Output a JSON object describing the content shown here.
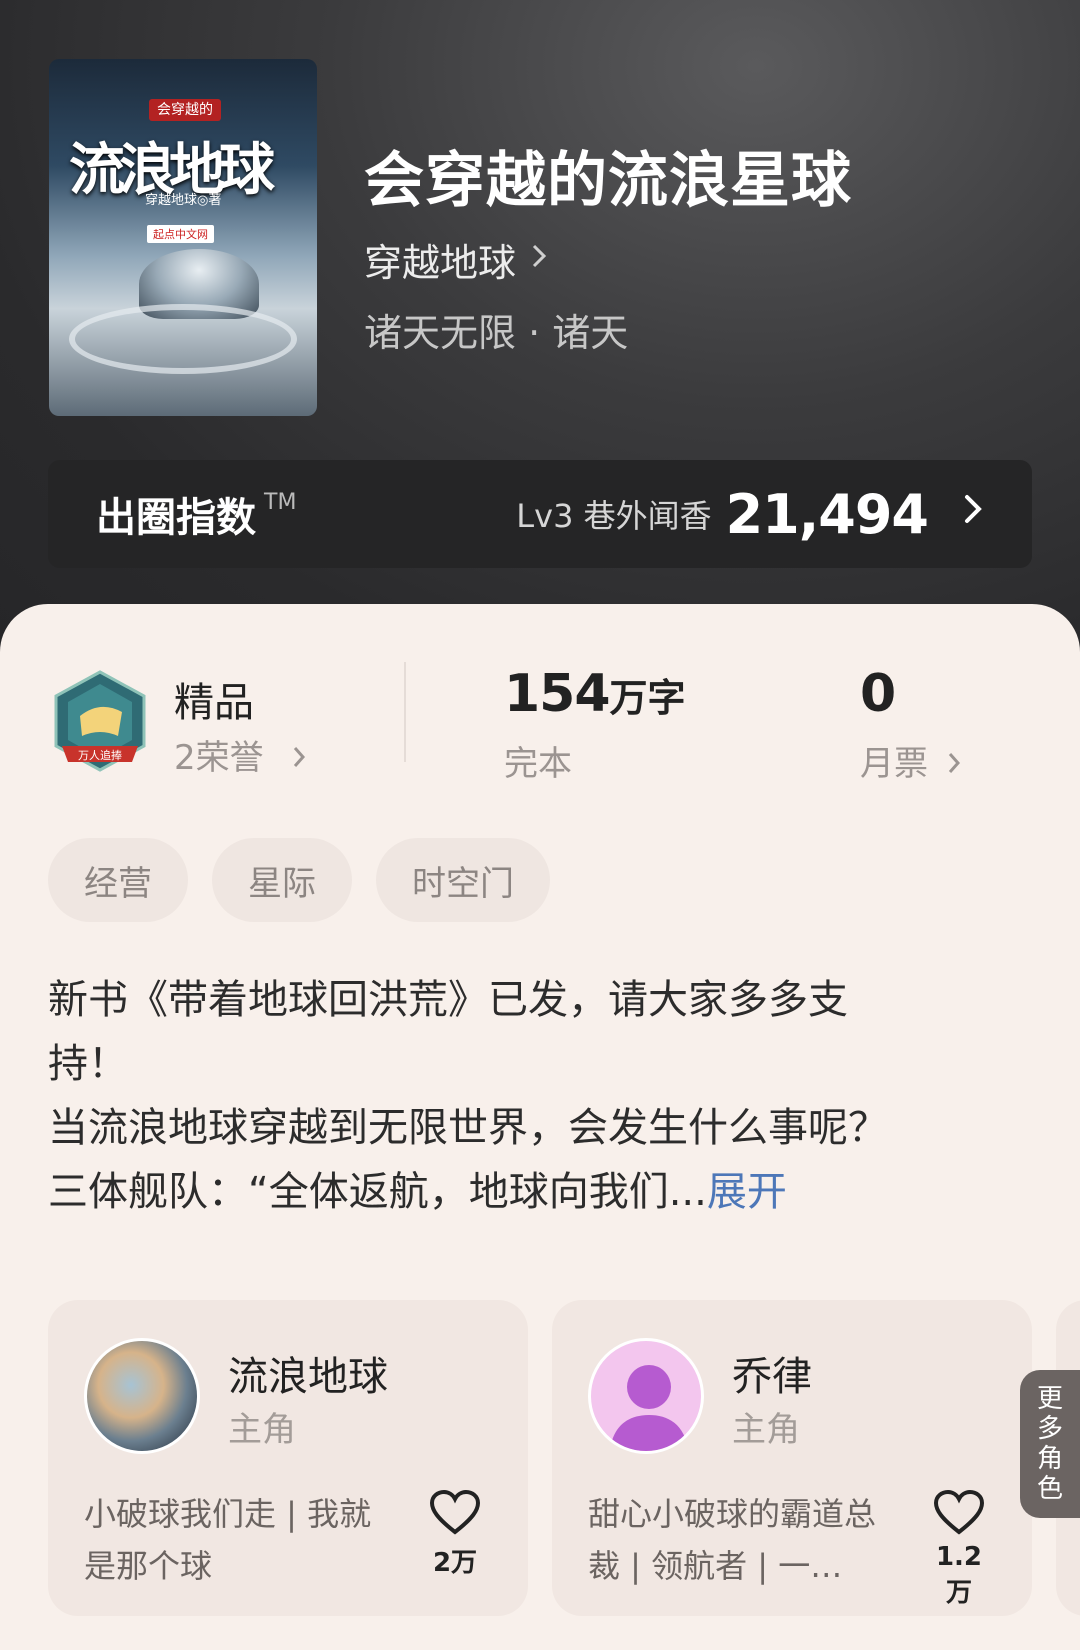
{
  "book": {
    "title": "会穿越的流浪星球",
    "author": "穿越地球",
    "genre": "诸天无限 · 诸天",
    "cover": {
      "small_title": "会穿越的",
      "big_title": "流浪地球",
      "author": "穿越地球◎著",
      "publisher": "起点中文网"
    }
  },
  "index": {
    "label": "出圈指数",
    "tm": "TM",
    "level": "Lv3 巷外闻香",
    "score": "21,494"
  },
  "stats": {
    "honor_title": "精品",
    "honor_sub": "2荣誉",
    "badge_text": "万人追捧",
    "words_num": "154",
    "words_unit": "万字",
    "words_sub": "完本",
    "tickets": "0",
    "tickets_sub": "月票"
  },
  "tags": [
    "经营",
    "星际",
    "时空门"
  ],
  "description": {
    "lines": [
      "新书《带着地球回洪荒》已发，请大家多多支",
      "持！",
      "当流浪地球穿越到无限世界，会发生什么事呢？"
    ],
    "last_line": "三体舰队：“全体返航，地球向我们...",
    "expand": "展开"
  },
  "characters": [
    {
      "name": "流浪地球",
      "role": "主角",
      "desc": "小破球我们走 | 我就是那个球",
      "likes": "2万"
    },
    {
      "name": "乔律",
      "role": "主角",
      "desc": "甜心小破球的霸道总裁 | 领航者 | 一…",
      "likes": "1.2万"
    }
  ],
  "more_roles": [
    "更",
    "多",
    "角",
    "色"
  ]
}
